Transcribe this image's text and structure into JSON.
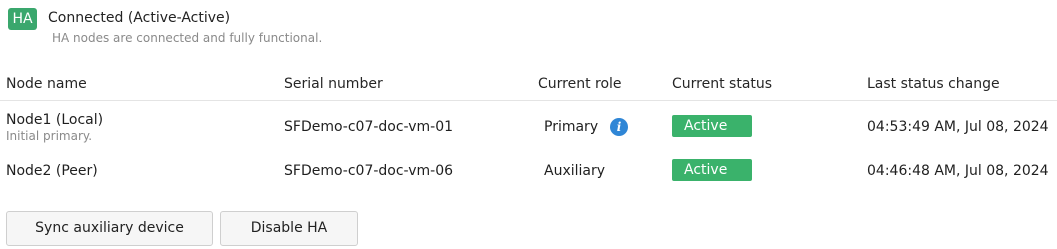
{
  "header": {
    "badge": "HA",
    "title": "Connected (Active-Active)",
    "subtitle": "HA nodes are connected and fully functional."
  },
  "table": {
    "columns": [
      "Node name",
      "Serial number",
      "Current role",
      "Current status",
      "Last status change"
    ],
    "rows": [
      {
        "node": "Node1 (Local)",
        "node_note": "Initial primary.",
        "serial": "SFDemo-c07-doc-vm-01",
        "role": "Primary",
        "role_icon": "info-icon",
        "status": "Active",
        "last_change": "04:53:49 AM, Jul 08, 2024"
      },
      {
        "node": "Node2 (Peer)",
        "serial": "SFDemo-c07-doc-vm-06",
        "role": "Auxiliary",
        "status": "Active",
        "last_change": "04:46:48 AM, Jul 08, 2024"
      }
    ]
  },
  "actions": {
    "sync_label": "Sync auxiliary device",
    "disable_label": "Disable HA"
  },
  "colors": {
    "ha_badge": "#3aa76d",
    "status_active": "#3ab26b",
    "info_icon": "#2f86d6"
  }
}
